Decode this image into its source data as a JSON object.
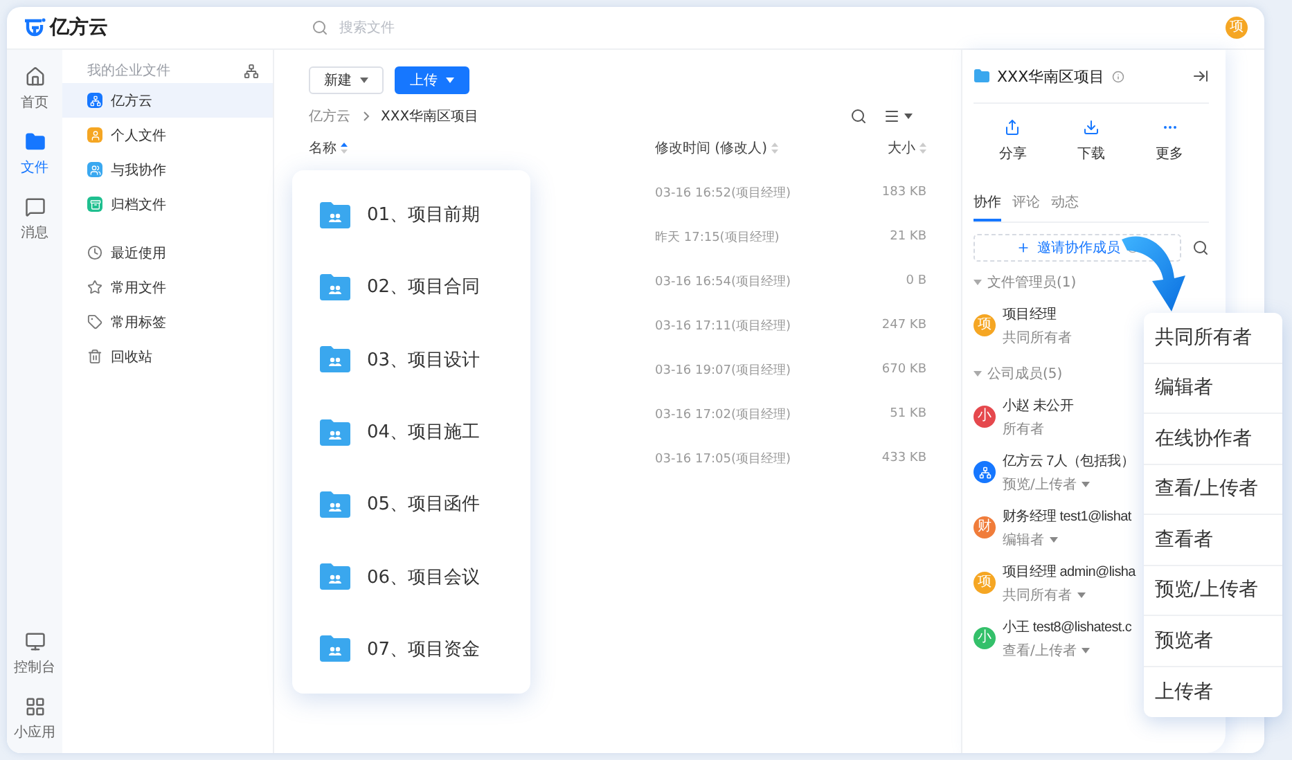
{
  "header": {
    "logo": "亿方云",
    "search": {
      "placeholder": "搜索文件"
    },
    "avatar": {
      "text": "项",
      "color": "#f5a623"
    }
  },
  "rail": {
    "items": [
      {
        "label": "首页",
        "selected": false
      },
      {
        "label": "文件",
        "selected": true
      },
      {
        "label": "消息",
        "selected": false
      }
    ],
    "bottom": [
      {
        "label": "控制台"
      },
      {
        "label": "小应用"
      }
    ]
  },
  "sidebar": {
    "section_title": "我的企业文件",
    "spaces": [
      {
        "label": "亿方云",
        "color": "#1677ff",
        "selected": true
      },
      {
        "label": "个人文件",
        "color": "#f5a623",
        "selected": false
      },
      {
        "label": "与我协作",
        "color": "#3aa8f0",
        "selected": false
      },
      {
        "label": "归档文件",
        "color": "#1fbf8f",
        "selected": false
      }
    ],
    "links": [
      {
        "label": "最近使用"
      },
      {
        "label": "常用文件"
      },
      {
        "label": "常用标签"
      },
      {
        "label": "回收站"
      }
    ]
  },
  "toolbar": {
    "buttons": [
      {
        "label": "新建",
        "kind": "default"
      },
      {
        "label": "上传",
        "kind": "primary"
      }
    ]
  },
  "breadcrumb": [
    "亿方云",
    "XXX华南区项目"
  ],
  "table": {
    "columns": [
      "名称",
      "修改时间 (修改人)",
      "大小"
    ],
    "rows": [
      {
        "modified": "03-16 16:52(项目经理)",
        "size": "183 KB"
      },
      {
        "modified": "昨天 17:15(项目经理)",
        "size": "21 KB"
      },
      {
        "modified": "03-16 16:54(项目经理)",
        "size": "0 B"
      },
      {
        "modified": "03-16 17:11(项目经理)",
        "size": "247 KB"
      },
      {
        "modified": "03-16 19:07(项目经理)",
        "size": "670 KB"
      },
      {
        "modified": "03-16 17:02(项目经理)",
        "size": "51 KB"
      },
      {
        "modified": "03-16 17:05(项目经理)",
        "size": "433 KB"
      }
    ]
  },
  "folder_card": {
    "folders": [
      "01、项目前期",
      "02、项目合同",
      "03、项目设计",
      "04、项目施工",
      "05、项目函件",
      "06、项目会议",
      "07、项目资金"
    ]
  },
  "details": {
    "title": "XXX华南区项目",
    "actions": [
      {
        "label": "分享"
      },
      {
        "label": "下载"
      },
      {
        "label": "更多"
      }
    ],
    "tabs": [
      {
        "label": "协作",
        "selected": true
      },
      {
        "label": "评论",
        "selected": false
      },
      {
        "label": "动态",
        "selected": false
      }
    ],
    "invite": "邀请协作成员",
    "groups": [
      {
        "title": "文件管理员(1)",
        "members": [
          {
            "kind": "person",
            "avatar": "项",
            "color": "#f5a623",
            "name": "项目经理",
            "role": "共同所有者",
            "has_menu": false
          }
        ]
      },
      {
        "title": "公司成员(5)",
        "members": [
          {
            "kind": "person",
            "avatar": "小",
            "color": "#e5484d",
            "name": "小赵 未公开",
            "role": "所有者",
            "has_menu": false
          },
          {
            "kind": "group",
            "color": "#1677ff",
            "name": "亿方云 7人（包括我）",
            "role": "预览/上传者",
            "has_menu": true
          },
          {
            "kind": "person",
            "avatar": "财",
            "color": "#f07c3a",
            "name": "财务经理 test1@lishat",
            "role": "编辑者",
            "has_menu": true
          },
          {
            "kind": "person",
            "avatar": "项",
            "color": "#f5a623",
            "name": "项目经理 admin@lisha",
            "role": "共同所有者",
            "has_menu": true
          },
          {
            "kind": "person",
            "avatar": "小",
            "color": "#34c06a",
            "name": "小王 test8@lishatest.c",
            "role": "查看/上传者",
            "has_menu": true
          }
        ]
      }
    ]
  },
  "role_menu": {
    "options": [
      "共同所有者",
      "编辑者",
      "在线协作者",
      "查看/上传者",
      "查看者",
      "预览/上传者",
      "预览者",
      "上传者"
    ]
  }
}
